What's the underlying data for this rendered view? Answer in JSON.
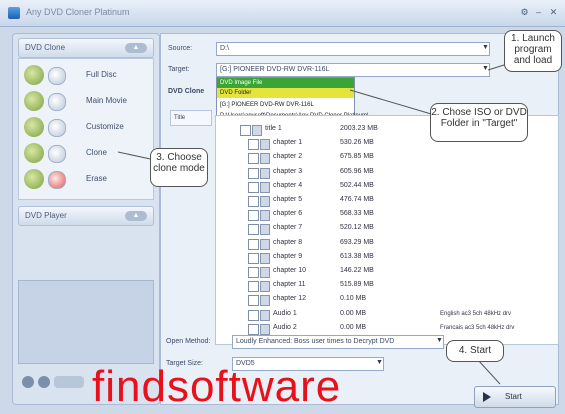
{
  "window": {
    "title": "Any DVD Cloner Platinum"
  },
  "left": {
    "clone_header": "DVD Clone",
    "player_header": "DVD Player",
    "modes": [
      "Full Disc",
      "Main Movie",
      "Customize",
      "Clone",
      "Erase"
    ]
  },
  "main": {
    "source_label": "Source:",
    "source_value": "D:\\",
    "target_label": "Target:",
    "target_value": "[G:] PIONEER DVD-RW DVR-116L",
    "dropdown_options": [
      "DVD Image File",
      "DVD Folder",
      "[G:] PIONEER DVD-RW DVR-116L",
      "D:\\Users\\anvsoft\\Documents\\Any DVD Cloner Platinum\\"
    ],
    "dvd_clone_label": "DVD Clone",
    "title_col": "Title",
    "rows": [
      {
        "name": "title 1",
        "size": "2003.23 MB",
        "note": ""
      },
      {
        "name": "chapter 1",
        "size": "530.26 MB",
        "note": ""
      },
      {
        "name": "chapter 2",
        "size": "675.85 MB",
        "note": ""
      },
      {
        "name": "chapter 3",
        "size": "605.96 MB",
        "note": ""
      },
      {
        "name": "chapter 4",
        "size": "502.44 MB",
        "note": ""
      },
      {
        "name": "chapter 5",
        "size": "476.74 MB",
        "note": ""
      },
      {
        "name": "chapter 6",
        "size": "568.33 MB",
        "note": ""
      },
      {
        "name": "chapter 7",
        "size": "520.12 MB",
        "note": ""
      },
      {
        "name": "chapter 8",
        "size": "693.29 MB",
        "note": ""
      },
      {
        "name": "chapter 9",
        "size": "613.38 MB",
        "note": ""
      },
      {
        "name": "chapter 10",
        "size": "146.22 MB",
        "note": ""
      },
      {
        "name": "chapter 11",
        "size": "515.89 MB",
        "note": ""
      },
      {
        "name": "chapter 12",
        "size": "0.10 MB",
        "note": ""
      },
      {
        "name": "Audio 1",
        "size": "0.00 MB",
        "note": "English ac3 5ch 48kHz drv"
      },
      {
        "name": "Audio 2",
        "size": "0.00 MB",
        "note": "Francais ac3 5ch 48kHz drv"
      }
    ],
    "open_method_label": "Open Method:",
    "open_method_value": "Loudly Enhanced: Boss user times to Decrypt DVD",
    "target_size_label": "Target Size:",
    "target_size_value": "DVD5",
    "start_label": "Start"
  },
  "callouts": {
    "c1": "1. Launch program and load",
    "c2": "2. Chose ISO or DVD Folder in \"Target\"",
    "c3": "3. Choose clone mode",
    "c4": "4. Start"
  },
  "watermark": "findsoftware",
  "colors": {
    "dropdown_iso": "#3aa536",
    "dropdown_folder": "#e5e43a",
    "watermark": "#e7101b"
  }
}
